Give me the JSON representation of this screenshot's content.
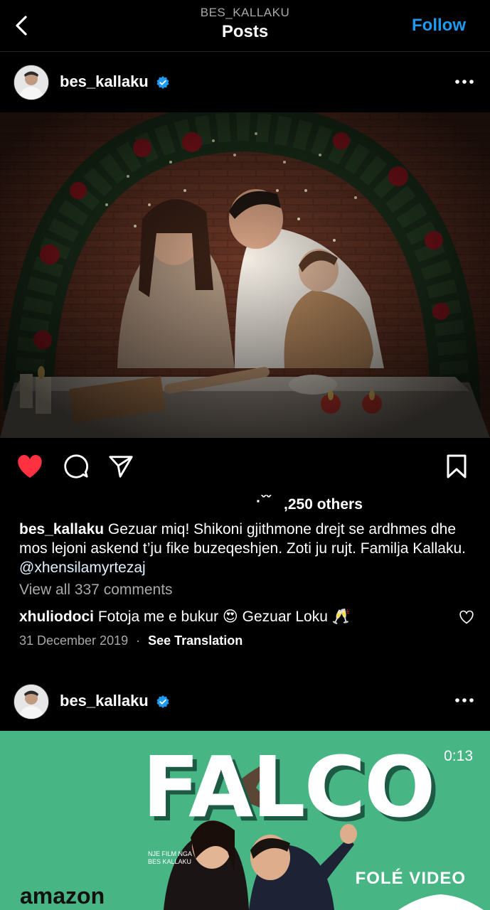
{
  "nav": {
    "username_caps": "BES_KALLAKU",
    "title": "Posts",
    "follow_label": "Follow"
  },
  "post1": {
    "username": "bes_kallaku",
    "verified": true,
    "liked": true,
    "likes_text": ",250 others",
    "likes_prefix_glyphs": "·ˇˇ",
    "caption_user": "bes_kallaku",
    "caption_text": " Gezuar miq! Shikoni gjithmone drejt se ardhmes dhe mos lejoni askend t’ju fike buzeqeshjen. Zoti ju rujt. Familja Kallaku. ",
    "caption_mention": "@xhensilamyrtezaj",
    "view_comments": "View all 337 comments",
    "comment_user": "xhuliodoci",
    "comment_text_before": " Fotoja me e bukur ",
    "comment_emoji": "😍",
    "comment_text_after": " Gezuar Loku ",
    "comment_emoji2": "🥂",
    "date": "31 December 2019",
    "separator": "·",
    "see_translation": "See Translation"
  },
  "post2": {
    "username": "bes_kallaku",
    "verified": true,
    "video_title": "FALCO",
    "duration": "0:13",
    "credits": "NJE FILM NGA\nBES KALLAKU",
    "brand_left": "amazon",
    "brand_right": "FOLÉ VIDEO"
  },
  "colors": {
    "accent_blue": "#1e9bf0",
    "like_red": "#ff3040",
    "video_bg": "#3fb07e"
  },
  "icons": [
    "back-arrow-icon",
    "verified-badge-icon",
    "more-options-icon",
    "heart-icon",
    "comment-icon",
    "share-icon",
    "bookmark-icon",
    "small-heart-icon"
  ]
}
